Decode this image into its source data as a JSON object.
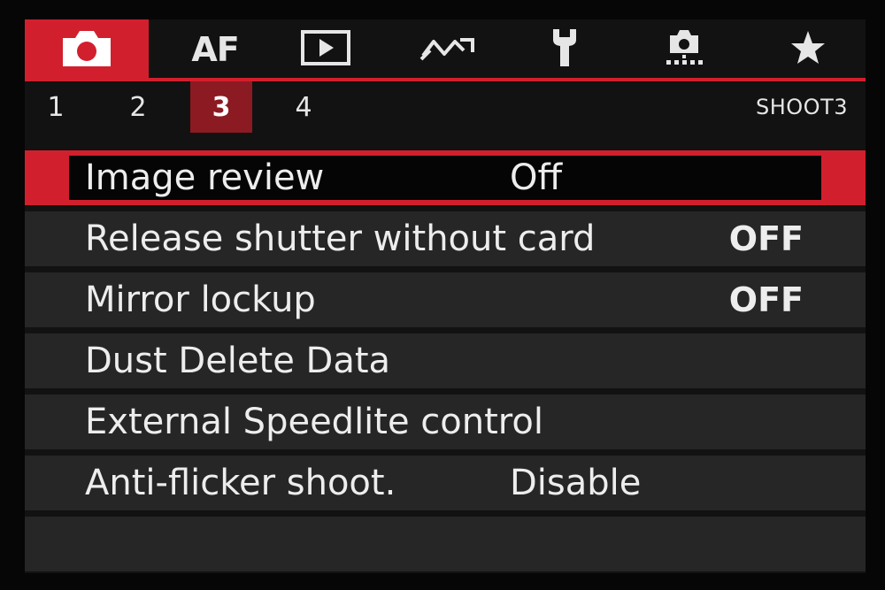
{
  "tabs": [
    {
      "name": "camera-icon",
      "label": ""
    },
    {
      "name": "af",
      "label": "AF"
    },
    {
      "name": "playback-icon",
      "label": ""
    },
    {
      "name": "wireless-icon",
      "label": ""
    },
    {
      "name": "wrench-icon",
      "label": ""
    },
    {
      "name": "custom-function-icon",
      "label": ""
    },
    {
      "name": "star-icon",
      "label": ""
    }
  ],
  "active_tab": "camera",
  "subtabs": [
    "1",
    "2",
    "3",
    "4"
  ],
  "active_subtab": "3",
  "page_name": "SHOOT3",
  "menu": [
    {
      "label": "Image review",
      "value": "Off"
    },
    {
      "label": "Release shutter without card",
      "value": "OFF"
    },
    {
      "label": "Mirror lockup",
      "value": "OFF"
    },
    {
      "label": "Dust Delete Data",
      "value": ""
    },
    {
      "label": "External Speedlite control",
      "value": ""
    },
    {
      "label": "Anti-flicker shoot.",
      "value": "Disable"
    }
  ],
  "colors": {
    "accent": "#d21f2d",
    "accent_dark": "#8c1a22",
    "row_bg": "#262626"
  }
}
